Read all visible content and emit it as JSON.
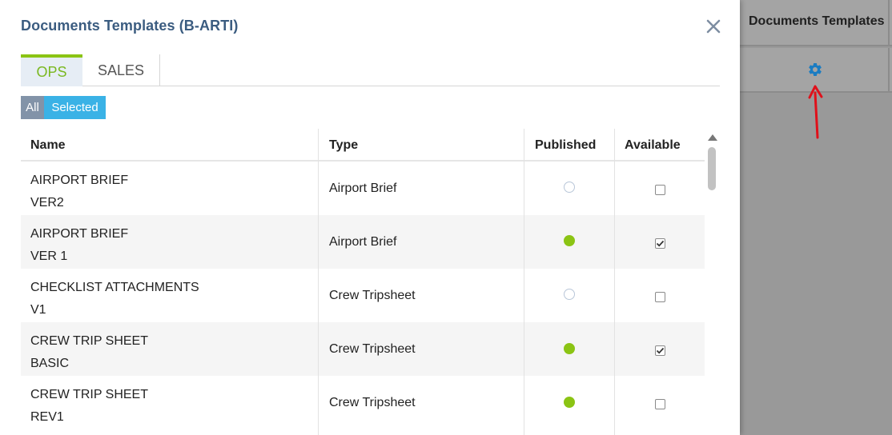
{
  "background": {
    "header_label": "Documents Templates",
    "gear_icon": "gear-icon",
    "arrow_color": "#e0101a",
    "gear_color": "#1a7cc2"
  },
  "modal": {
    "title": "Documents Templates (B-ARTI)",
    "close_icon": "close-icon",
    "tabs": [
      {
        "label": "OPS",
        "active": true
      },
      {
        "label": "SALES",
        "active": false
      }
    ],
    "filter": {
      "all_label": "All",
      "selected_label": "Selected"
    },
    "table": {
      "columns": [
        "Name",
        "Type",
        "Published",
        "Available"
      ],
      "rows": [
        {
          "name_line1": "AIRPORT BRIEF",
          "name_line2": "VER2",
          "type": "Airport Brief",
          "published": false,
          "available": false
        },
        {
          "name_line1": "AIRPORT BRIEF",
          "name_line2": "VER 1",
          "type": "Airport Brief",
          "published": true,
          "available": true
        },
        {
          "name_line1": "CHECKLIST ATTACHMENTS",
          "name_line2": "V1",
          "type": "Crew Tripsheet",
          "published": false,
          "available": false
        },
        {
          "name_line1": "CREW TRIP SHEET",
          "name_line2": "BASIC",
          "type": "Crew Tripsheet",
          "published": true,
          "available": true
        },
        {
          "name_line1": "CREW TRIP SHEET",
          "name_line2": "REV1",
          "type": "Crew Tripsheet",
          "published": true,
          "available": false
        }
      ]
    }
  },
  "colors": {
    "title": "#3b5c80",
    "accent_green": "#8bc414",
    "filter_all_bg": "#8293a8",
    "filter_selected_bg": "#3ab2e6"
  }
}
